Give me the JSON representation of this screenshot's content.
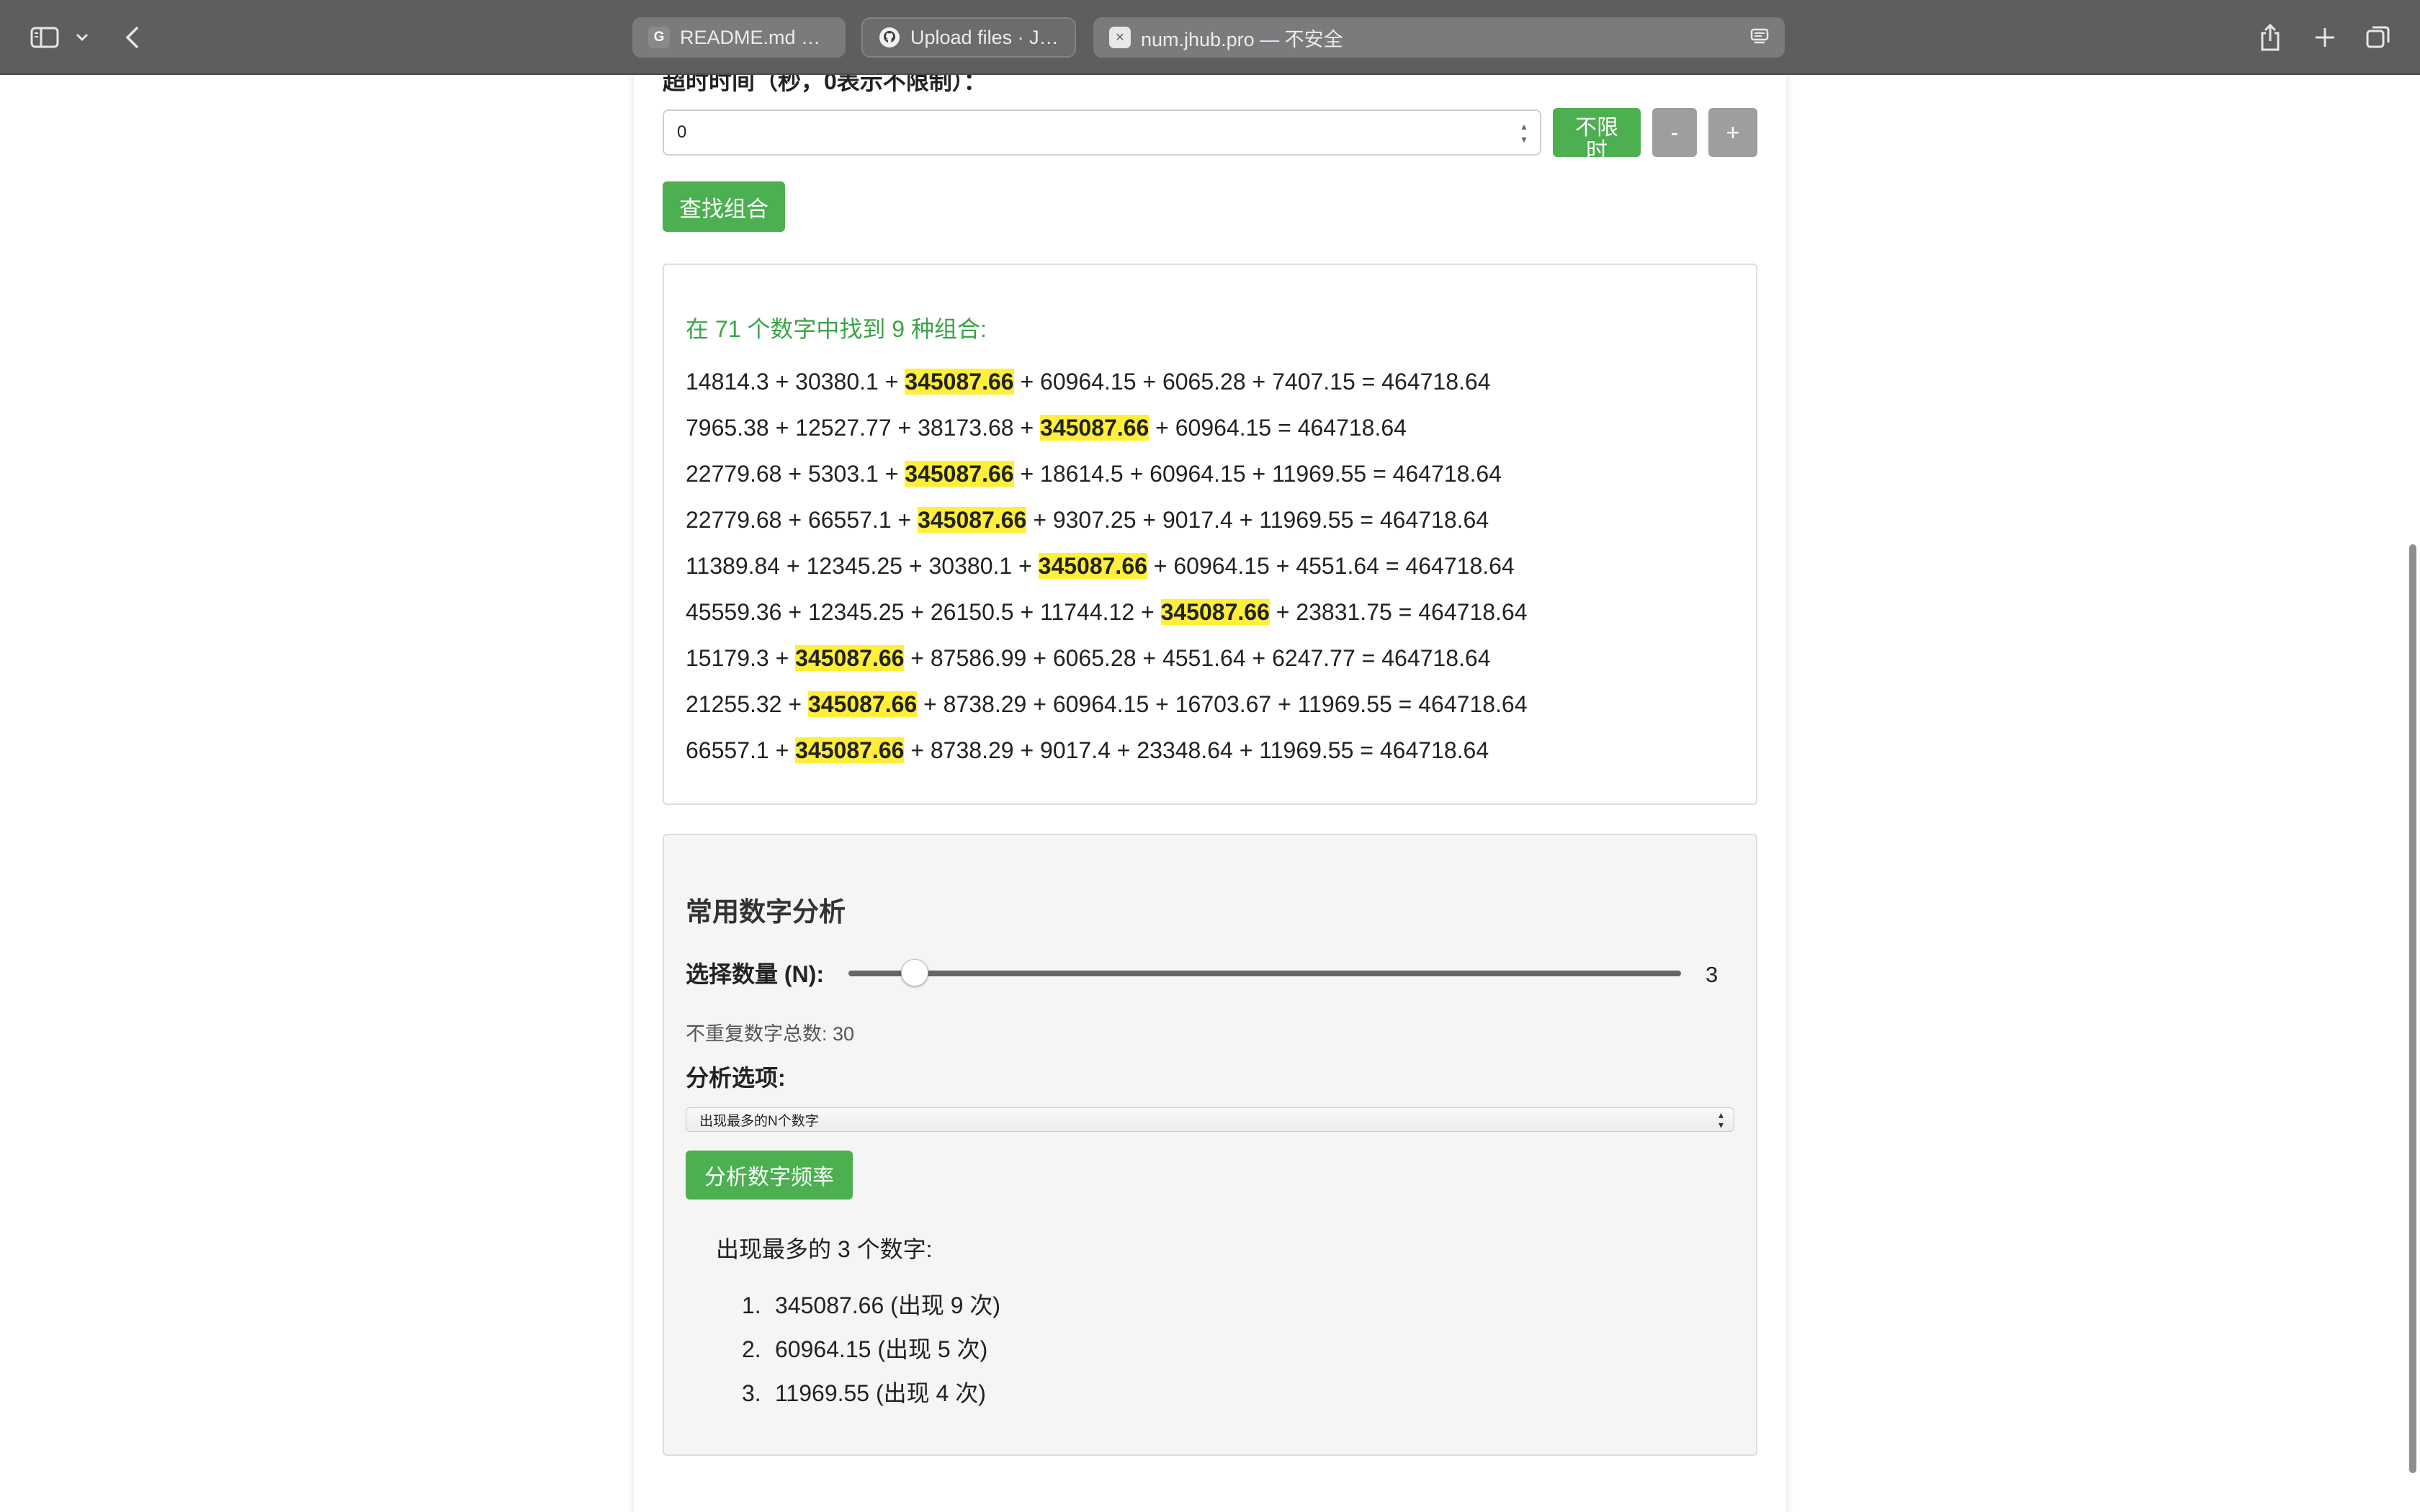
{
  "browser": {
    "tabs": [
      {
        "favicon": "G",
        "title": "README.md —..."
      },
      {
        "favicon": "github-icon",
        "title": "Upload files · Ji..."
      },
      {
        "favicon": "x-icon",
        "title": "num.jhub.pro — 不安全"
      }
    ]
  },
  "timeout": {
    "label": "超时时间（秒，0表示不限制）：",
    "value": "0",
    "unlimited_label": "不限时",
    "minus_label": "-",
    "plus_label": "+"
  },
  "find_button": "查找组合",
  "results": {
    "summary": "在 71 个数字中找到 9 种组合:",
    "highlight": "345087.66",
    "lines": [
      {
        "before": "14814.3 + 30380.1 + ",
        "after": " + 60964.15 + 6065.28 + 7407.15 = 464718.64"
      },
      {
        "before": "7965.38 + 12527.77 + 38173.68 + ",
        "after": " + 60964.15 = 464718.64"
      },
      {
        "before": "22779.68 + 5303.1 + ",
        "after": " + 18614.5 + 60964.15 + 11969.55 = 464718.64"
      },
      {
        "before": "22779.68 + 66557.1 + ",
        "after": " + 9307.25 + 9017.4 + 11969.55 = 464718.64"
      },
      {
        "before": "11389.84 + 12345.25 + 30380.1 + ",
        "after": " + 60964.15 + 4551.64 = 464718.64"
      },
      {
        "before": "45559.36 + 12345.25 + 26150.5 + 11744.12 + ",
        "after": " + 23831.75 = 464718.64"
      },
      {
        "before": "15179.3 + ",
        "after": " + 87586.99 + 6065.28 + 4551.64 + 6247.77 = 464718.64"
      },
      {
        "before": "21255.32 + ",
        "after": " + 8738.29 + 60964.15 + 16703.67 + 11969.55 = 464718.64"
      },
      {
        "before": "66557.1 + ",
        "after": " + 8738.29 + 9017.4 + 23348.64 + 11969.55 = 464718.64"
      }
    ]
  },
  "analysis": {
    "title": "常用数字分析",
    "slider_label": "选择数量 (N):",
    "slider_value": "3",
    "slider_fraction": 0.08,
    "unique_count": "不重复数字总数: 30",
    "options_label": "分析选项:",
    "options_selected": "出现最多的N个数字",
    "analyze_button": "分析数字频率",
    "freq_header": "出现最多的 3 个数字:",
    "freq_items": [
      {
        "num": "1.",
        "text": "345087.66 (出现 9 次)"
      },
      {
        "num": "2.",
        "text": "60964.15 (出现 5 次)"
      },
      {
        "num": "3.",
        "text": "11969.55 (出现 4 次)"
      }
    ]
  }
}
